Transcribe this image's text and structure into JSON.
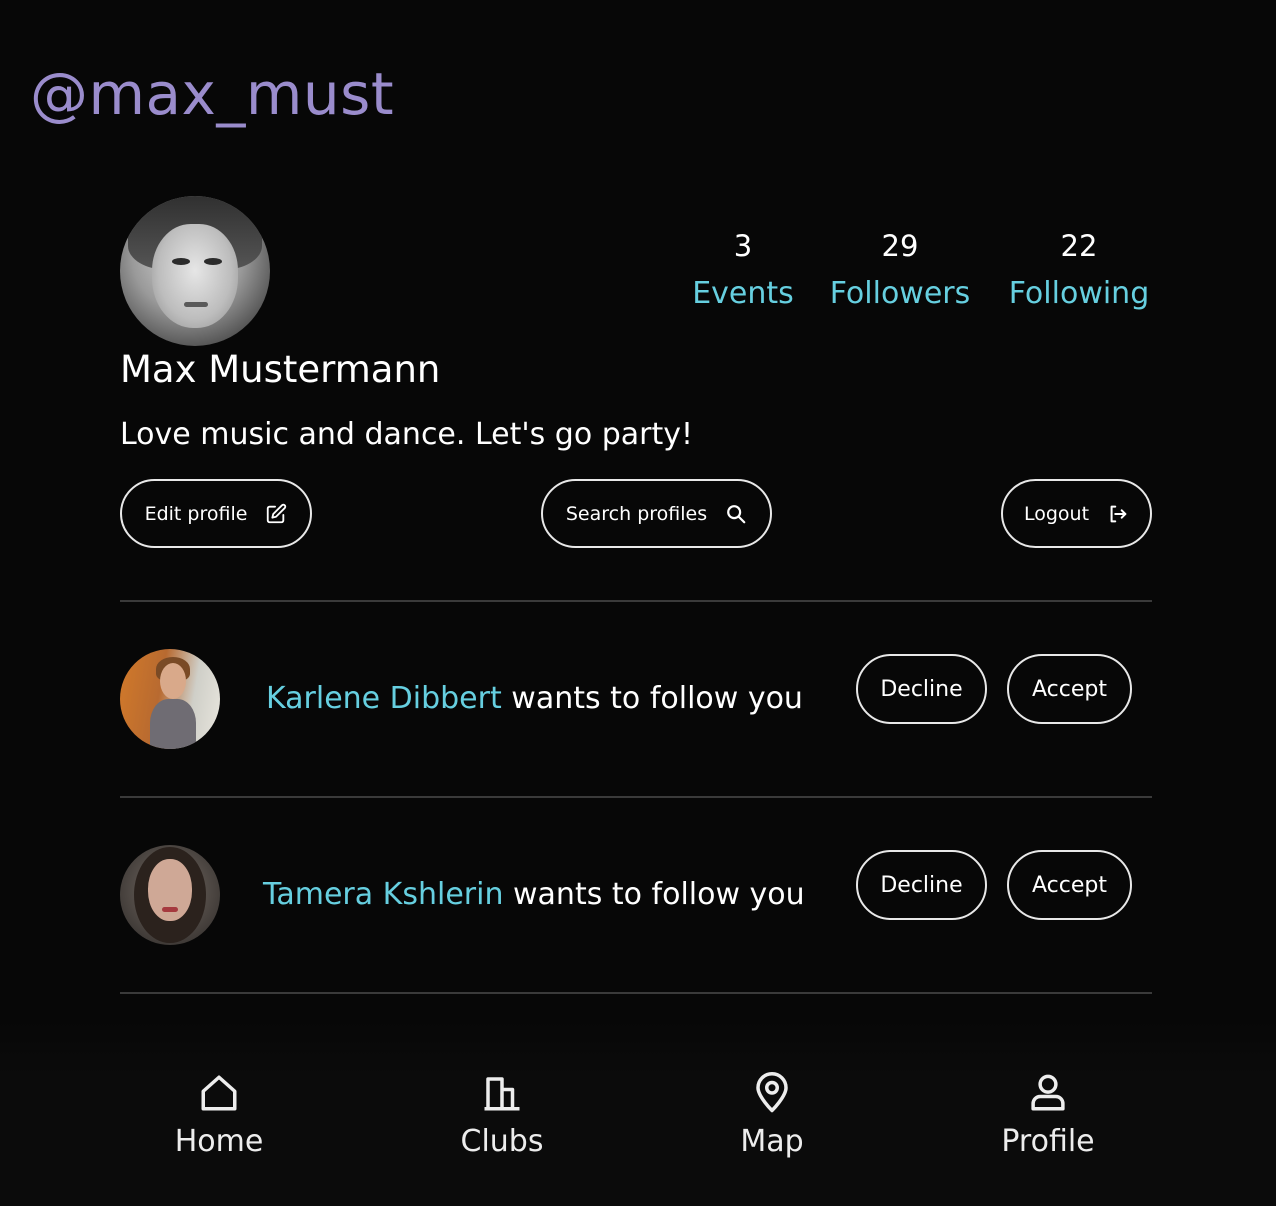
{
  "header": {
    "handle": "@max_must"
  },
  "profile": {
    "name": "Max Mustermann",
    "bio": "Love music and dance. Let's go party!",
    "stats": {
      "events": {
        "count": "3",
        "label": "Events"
      },
      "followers": {
        "count": "29",
        "label": "Followers"
      },
      "following": {
        "count": "22",
        "label": "Following"
      }
    }
  },
  "actions": {
    "edit_label": "Edit profile",
    "search_label": "Search profiles",
    "logout_label": "Logout"
  },
  "requests": [
    {
      "name": "Karlene Dibbert",
      "message": "wants to follow you",
      "decline_label": "Decline",
      "accept_label": "Accept"
    },
    {
      "name": "Tamera Kshlerin",
      "message": "wants to follow you",
      "decline_label": "Decline",
      "accept_label": "Accept"
    }
  ],
  "nav": {
    "home": "Home",
    "clubs": "Clubs",
    "map": "Map",
    "profile": "Profile"
  },
  "colors": {
    "handle": "#9a8ccc",
    "accent": "#66cfe0",
    "background": "#070707"
  }
}
